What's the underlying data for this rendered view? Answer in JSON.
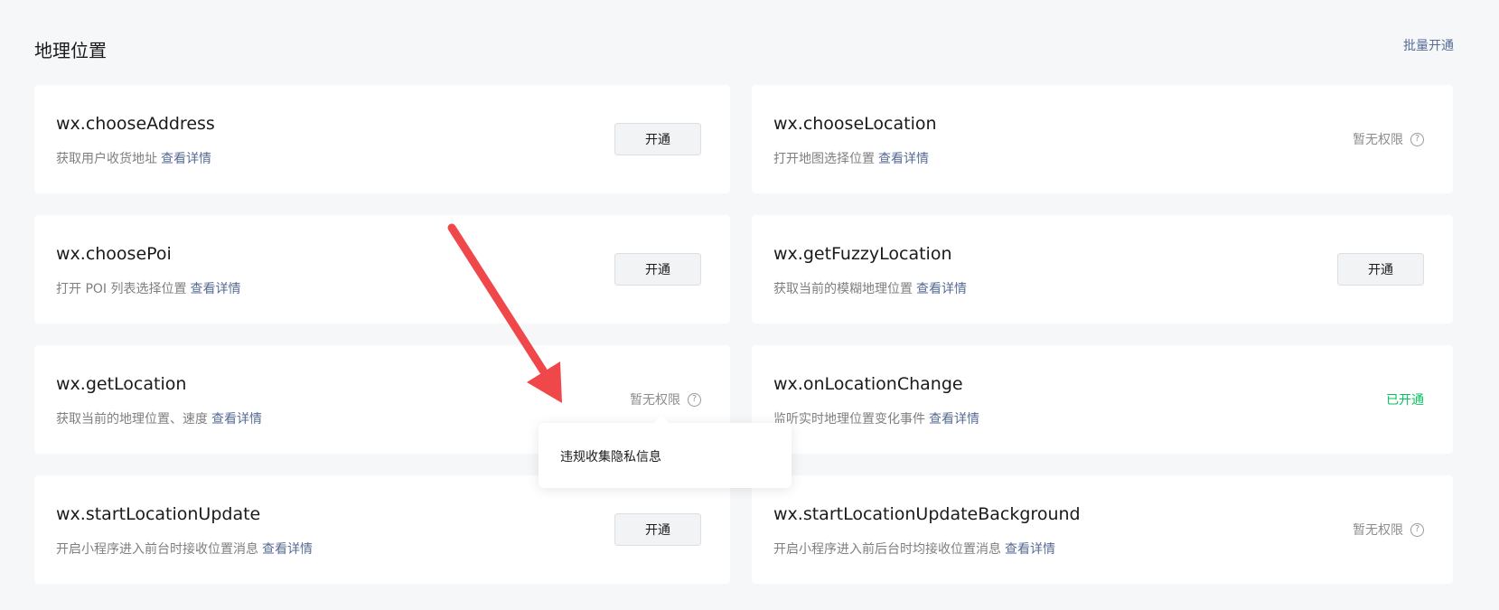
{
  "section": {
    "title": "地理位置",
    "batch_open": "批量开通"
  },
  "apis": [
    {
      "name": "wx.chooseAddress",
      "desc": "获取用户收货地址",
      "detail": "查看详情",
      "status": "button",
      "action": "开通"
    },
    {
      "name": "wx.chooseLocation",
      "desc": "打开地图选择位置",
      "detail": "查看详情",
      "status": "no_permission",
      "action": "暂无权限"
    },
    {
      "name": "wx.choosePoi",
      "desc": "打开 POI 列表选择位置",
      "detail": "查看详情",
      "status": "button",
      "action": "开通"
    },
    {
      "name": "wx.getFuzzyLocation",
      "desc": "获取当前的模糊地理位置",
      "detail": "查看详情",
      "status": "button",
      "action": "开通"
    },
    {
      "name": "wx.getLocation",
      "desc": "获取当前的地理位置、速度",
      "detail": "查看详情",
      "status": "no_permission",
      "action": "暂无权限"
    },
    {
      "name": "wx.onLocationChange",
      "desc": "监听实时地理位置变化事件",
      "detail": "查看详情",
      "status": "enabled",
      "action": "已开通"
    },
    {
      "name": "wx.startLocationUpdate",
      "desc": "开启小程序进入前台时接收位置消息",
      "detail": "查看详情",
      "status": "button",
      "action": "开通"
    },
    {
      "name": "wx.startLocationUpdateBackground",
      "desc": "开启小程序进入前后台时均接收位置消息",
      "detail": "查看详情",
      "status": "no_permission",
      "action": "暂无权限"
    }
  ],
  "help_icon_glyph": "?",
  "tooltip": {
    "text": "违规收集隐私信息"
  },
  "colors": {
    "link": "#576b95",
    "enabled": "#07c160",
    "annotation_arrow": "#f0474b"
  }
}
